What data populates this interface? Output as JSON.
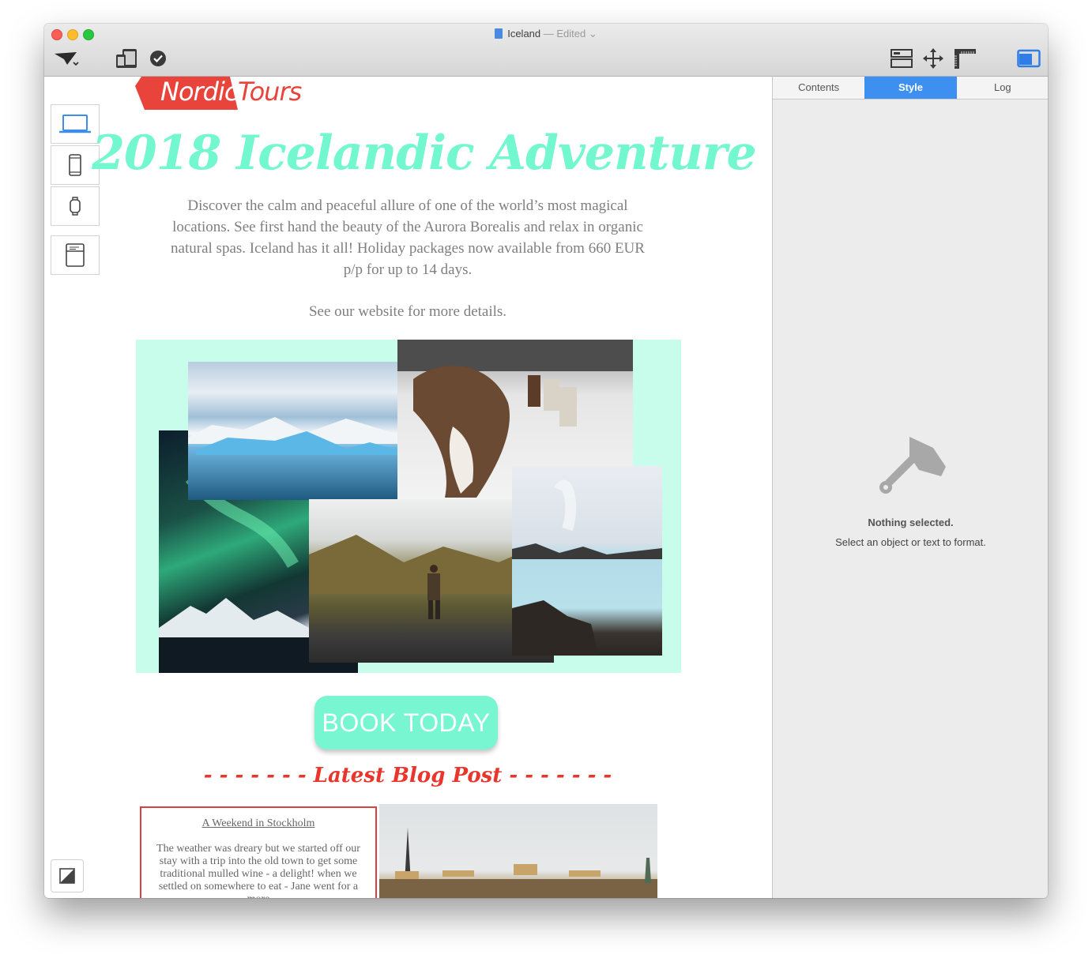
{
  "window": {
    "title": "Iceland",
    "edited": "— Edited"
  },
  "tabs": [
    {
      "label": "Contents"
    },
    {
      "label": "Style"
    },
    {
      "label": "Log"
    }
  ],
  "style_panel": {
    "empty_title": "Nothing selected.",
    "empty_subtitle": "Select an object or text to format."
  },
  "email": {
    "logo_left": "Nordic",
    "logo_right": "Tours",
    "headline": "2018 Icelandic Adventure",
    "intro": "Discover the calm and peaceful allure of one of the world’s most magical locations. See first hand the beauty of the Aurora Borealis and relax in organic natural spas. Iceland has it all! Holiday packages now available from 660 EUR p/p for up to 14 days.",
    "details": "See our website for more details.",
    "cta": "BOOK TODAY",
    "blog_heading": "- - - - - - - Latest Blog Post - - - - - - -",
    "blog_title": "A Weekend in Stockholm",
    "blog_body": "The weather was dreary but we started off our stay with a trip into the old town to get some traditional mulled wine - a delight! when we settled on somewhere to eat - Jane went for a more"
  },
  "colors": {
    "accent_mint": "#73f7cf",
    "collage_bg": "#c9fdeb",
    "brand_red": "#e8362c",
    "tab_active": "#3d8ff0"
  }
}
